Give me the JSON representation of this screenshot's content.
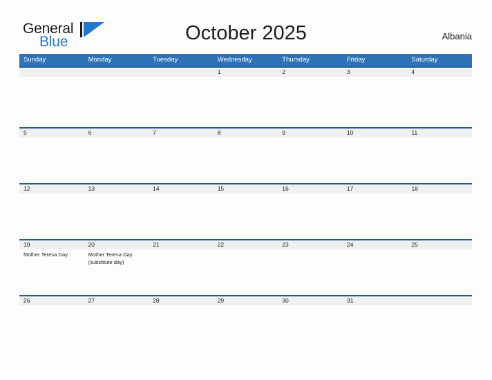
{
  "brand": {
    "name_top": "General",
    "name_bottom": "Blue",
    "flag_icon": "blue-flag-triangle-icon"
  },
  "header": {
    "title": "October 2025",
    "country": "Albania"
  },
  "colors": {
    "header_blue": "#2e73b8",
    "rule_blue": "#1f5e9e",
    "date_strip_gray": "#f0f0f0",
    "brand_blue": "#2277cc",
    "page_background": "#fdfdfd",
    "text": "#1c1c1c"
  },
  "calendar": {
    "month": "October",
    "year": "2025",
    "weekday_headers": [
      "Sunday",
      "Monday",
      "Tuesday",
      "Wednesday",
      "Thursday",
      "Friday",
      "Saturday"
    ],
    "weeks": [
      {
        "days": [
          {
            "date": "",
            "events": []
          },
          {
            "date": "",
            "events": []
          },
          {
            "date": "",
            "events": []
          },
          {
            "date": "1",
            "events": []
          },
          {
            "date": "2",
            "events": []
          },
          {
            "date": "3",
            "events": []
          },
          {
            "date": "4",
            "events": []
          }
        ]
      },
      {
        "days": [
          {
            "date": "5",
            "events": []
          },
          {
            "date": "6",
            "events": []
          },
          {
            "date": "7",
            "events": []
          },
          {
            "date": "8",
            "events": []
          },
          {
            "date": "9",
            "events": []
          },
          {
            "date": "10",
            "events": []
          },
          {
            "date": "11",
            "events": []
          }
        ]
      },
      {
        "days": [
          {
            "date": "12",
            "events": []
          },
          {
            "date": "13",
            "events": []
          },
          {
            "date": "14",
            "events": []
          },
          {
            "date": "15",
            "events": []
          },
          {
            "date": "16",
            "events": []
          },
          {
            "date": "17",
            "events": []
          },
          {
            "date": "18",
            "events": []
          }
        ]
      },
      {
        "days": [
          {
            "date": "19",
            "events": [
              "Mother Teresa Day"
            ]
          },
          {
            "date": "20",
            "events": [
              "Mother Teresa Day (substitute day)"
            ]
          },
          {
            "date": "21",
            "events": []
          },
          {
            "date": "22",
            "events": []
          },
          {
            "date": "23",
            "events": []
          },
          {
            "date": "24",
            "events": []
          },
          {
            "date": "25",
            "events": []
          }
        ]
      },
      {
        "days": [
          {
            "date": "26",
            "events": []
          },
          {
            "date": "27",
            "events": []
          },
          {
            "date": "28",
            "events": []
          },
          {
            "date": "29",
            "events": []
          },
          {
            "date": "30",
            "events": []
          },
          {
            "date": "31",
            "events": []
          },
          {
            "date": "",
            "events": []
          }
        ]
      }
    ]
  }
}
